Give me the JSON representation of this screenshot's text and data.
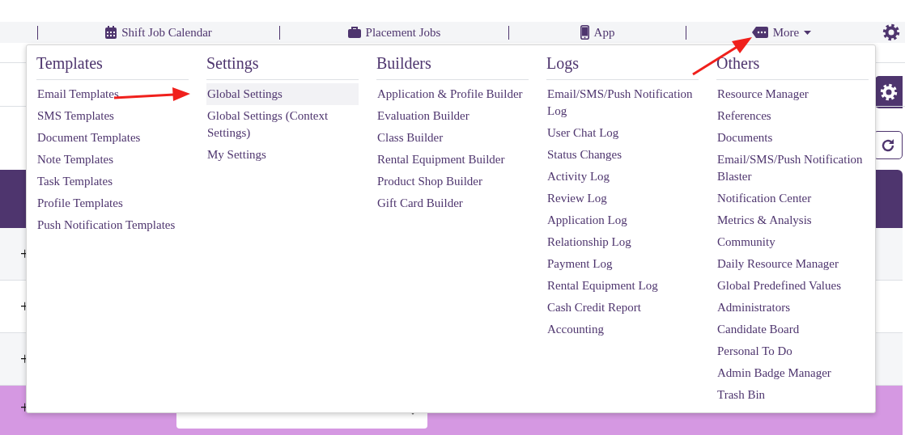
{
  "nav": {
    "items": [
      {
        "label": "Shift Job Calendar",
        "kind": "calendar"
      },
      {
        "label": "Placement Jobs",
        "kind": "briefcase"
      },
      {
        "label": "App",
        "kind": "phone"
      },
      {
        "label": "More",
        "kind": "more"
      }
    ]
  },
  "menu": {
    "columns": [
      {
        "title": "Templates",
        "items": [
          {
            "label": "Email Templates",
            "selected": false
          },
          {
            "label": "SMS Templates",
            "selected": false
          },
          {
            "label": "Document Templates",
            "selected": false
          },
          {
            "label": "Note Templates",
            "selected": false
          },
          {
            "label": "Task Templates",
            "selected": false
          },
          {
            "label": "Profile Templates",
            "selected": false
          },
          {
            "label": "Push Notification Templates",
            "selected": false
          }
        ]
      },
      {
        "title": "Settings",
        "items": [
          {
            "label": "Global Settings",
            "selected": true
          },
          {
            "label": "Global Settings (Context Settings)",
            "selected": false
          },
          {
            "label": "My Settings",
            "selected": false
          }
        ]
      },
      {
        "title": "Builders",
        "items": [
          {
            "label": "Application & Profile Builder",
            "selected": false
          },
          {
            "label": "Evaluation Builder",
            "selected": false
          },
          {
            "label": "Class Builder",
            "selected": false
          },
          {
            "label": "Rental Equipment Builder",
            "selected": false
          },
          {
            "label": "Product Shop Builder",
            "selected": false
          },
          {
            "label": "Gift Card Builder",
            "selected": false
          }
        ]
      },
      {
        "title": "Logs",
        "items": [
          {
            "label": "Email/SMS/Push Notification Log",
            "selected": false
          },
          {
            "label": "User Chat Log",
            "selected": false
          },
          {
            "label": "Status Changes",
            "selected": false
          },
          {
            "label": "Activity Log",
            "selected": false
          },
          {
            "label": "Review Log",
            "selected": false
          },
          {
            "label": "Application Log",
            "selected": false
          },
          {
            "label": "Relationship Log",
            "selected": false
          },
          {
            "label": "Payment Log",
            "selected": false
          },
          {
            "label": "Rental Equipment Log",
            "selected": false
          },
          {
            "label": "Cash Credit Report",
            "selected": false
          },
          {
            "label": "Accounting",
            "selected": false
          }
        ]
      },
      {
        "title": "Others",
        "items": [
          {
            "label": "Resource Manager",
            "selected": false
          },
          {
            "label": "References",
            "selected": false
          },
          {
            "label": "Documents",
            "selected": false
          },
          {
            "label": "Email/SMS/Push Notification Blaster",
            "selected": false
          },
          {
            "label": "Notification Center",
            "selected": false
          },
          {
            "label": "Metrics & Analysis",
            "selected": false
          },
          {
            "label": "Community",
            "selected": false
          },
          {
            "label": "Daily Resource Manager",
            "selected": false
          },
          {
            "label": "Global Predefined Values",
            "selected": false
          },
          {
            "label": "Administrators",
            "selected": false
          },
          {
            "label": "Candidate Board",
            "selected": false
          },
          {
            "label": "Personal To Do",
            "selected": false
          },
          {
            "label": "Admin Badge Manager",
            "selected": false
          },
          {
            "label": "Trash Bin",
            "selected": false
          }
        ]
      }
    ]
  },
  "table": {
    "rows": [
      {
        "toggle": "+",
        "highlighted": false
      },
      {
        "toggle": "+",
        "highlighted": false
      },
      {
        "toggle": "+",
        "highlighted": false
      },
      {
        "toggle": "+",
        "highlighted": true,
        "kind": "select"
      }
    ]
  }
}
